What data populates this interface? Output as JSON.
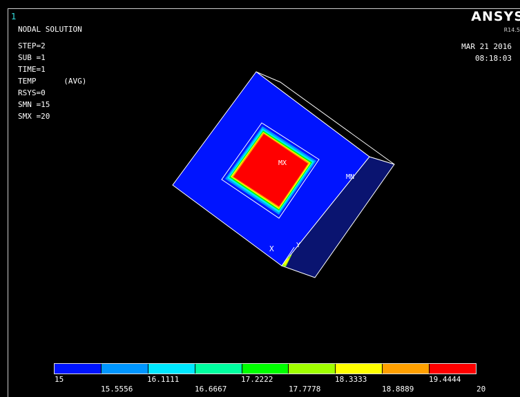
{
  "window": {
    "number": "1"
  },
  "plot": {
    "title": "NODAL SOLUTION",
    "info": [
      "STEP=2",
      "SUB =1",
      "TIME=1",
      "TEMP      (AVG)",
      "RSYS=0",
      "SMN =15",
      "SMX =20"
    ],
    "brand": "ANSYS",
    "release": "R14.5",
    "date": "MAR 21 2016",
    "time": "08:18:03",
    "labels": {
      "max": "MX",
      "min": "MN",
      "x_axis": "X",
      "y_axis": "Y"
    }
  },
  "legend": {
    "colors": [
      "#0014ff",
      "#0096ff",
      "#00e8ff",
      "#00ffa0",
      "#00ff00",
      "#a0ff00",
      "#ffff00",
      "#ffa000",
      "#ff0000"
    ],
    "upper_ticks": [
      "15",
      "16.1111",
      "17.2222",
      "18.3333",
      "19.4444"
    ],
    "lower_ticks": [
      "15.5556",
      "16.6667",
      "17.7778",
      "18.8889",
      "20"
    ]
  },
  "colors": {
    "face_blue": "#0014ff",
    "side_navy": "#0a1470",
    "hot_red": "#ff0000",
    "background": "#000000",
    "window_number": "#35e0e0"
  }
}
